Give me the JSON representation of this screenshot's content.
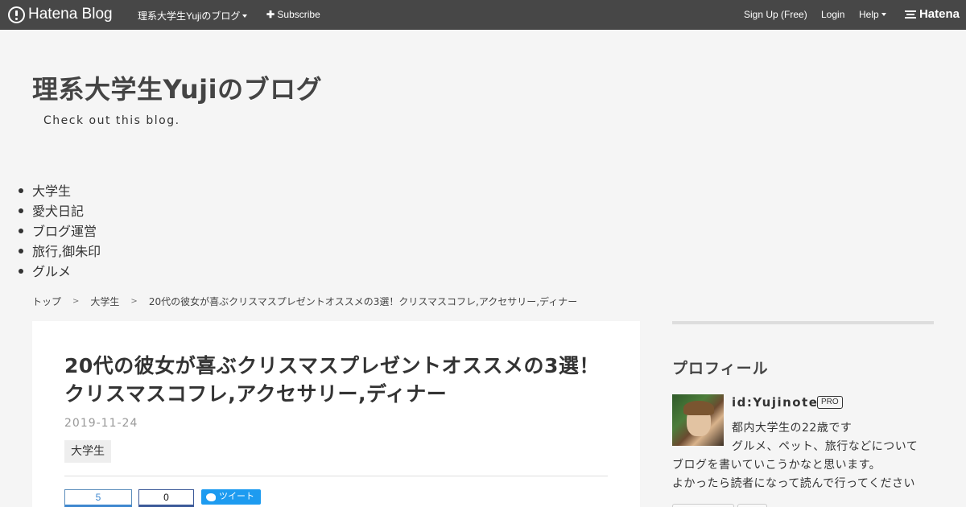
{
  "header": {
    "logo_text": "Hatena Blog",
    "blog_menu": "理系大学生Yujiのブログ",
    "subscribe": "Subscribe",
    "sign_up": "Sign Up (Free)",
    "login": "Login",
    "help": "Help",
    "hatena": "Hatena"
  },
  "blog": {
    "title": "理系大学生Yujiのブログ",
    "description": "Check out this blog."
  },
  "categories": [
    "大学生",
    "愛犬日記",
    "ブログ運営",
    "旅行,御朱印",
    "グルメ"
  ],
  "breadcrumb": {
    "top": "トップ",
    "category": "大学生",
    "current": "20代の彼女が喜ぶクリスマスプレゼントオススメの3選！クリスマスコフレ,アクセサリー,ディナー"
  },
  "entry": {
    "title": "20代の彼女が喜ぶクリスマスプレゼントオススメの3選！クリスマスコフレ,アクセサリー,ディナー",
    "date": "2019-11-24",
    "category": "大学生",
    "share": {
      "hatena_count": "5",
      "facebook_count": "0",
      "tweet": "ツイート"
    }
  },
  "sidebar": {
    "heading": "プロフィール",
    "profile_id": "id:Yujinote",
    "pro_badge": "PRO",
    "lines": [
      "都内大学生の22歳です",
      "グルメ、ペット、旅行などについて",
      "ブログを書いていこうかなと思います。",
      "よかったら読者になって読んで行ってください"
    ]
  }
}
